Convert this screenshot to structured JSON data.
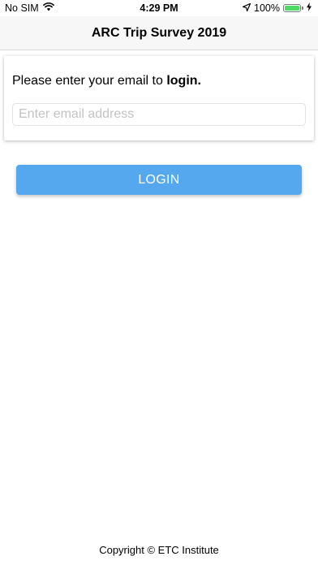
{
  "status_bar": {
    "carrier": "No SIM",
    "time": "4:29 PM",
    "battery_percent": "100%",
    "battery_level": 1.0,
    "battery_color": "#4cd964",
    "icons": [
      "wifi-icon",
      "location-arrow-icon",
      "battery-icon",
      "charging-bolt-icon"
    ]
  },
  "nav": {
    "title": "ARC Trip Survey 2019"
  },
  "login_card": {
    "prompt_text": "Please enter your email to ",
    "prompt_bold": "login.",
    "email_input": {
      "value": "",
      "placeholder": "Enter email address"
    }
  },
  "login_button": {
    "label": "LOGIN",
    "color": "#55a8ee"
  },
  "footer": {
    "copyright": "Copyright © ETC Institute"
  }
}
